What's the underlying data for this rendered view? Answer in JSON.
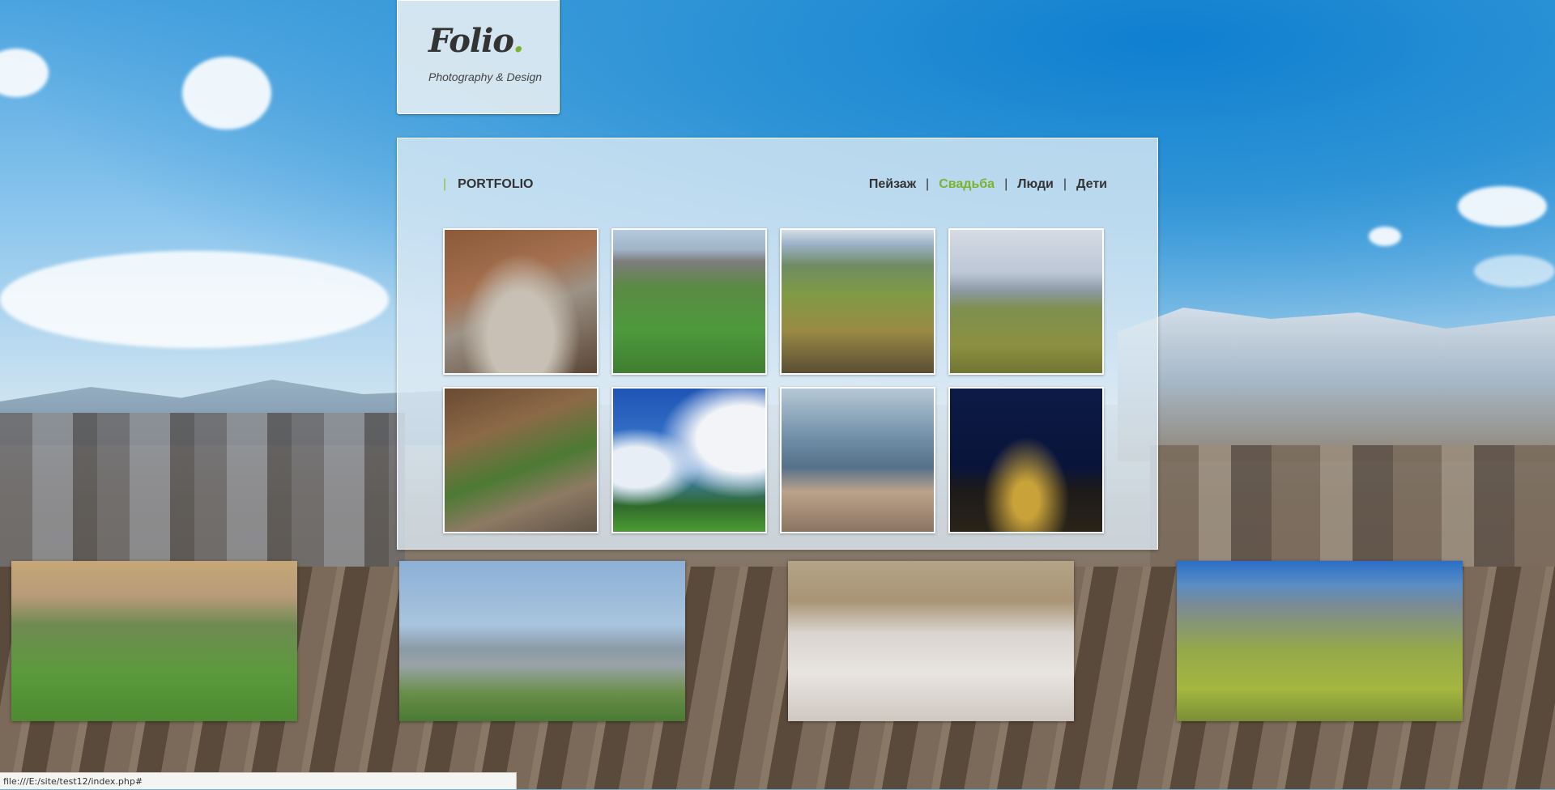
{
  "logo": {
    "title": "Folio",
    "dot": ".",
    "subtitle": "Photography & Design"
  },
  "portfolio": {
    "separator": "|",
    "title": "PORTFOLIO",
    "filters": [
      {
        "label": "Пейзаж",
        "active": false
      },
      {
        "label": "Свадьба",
        "active": true
      },
      {
        "label": "Люди",
        "active": false
      },
      {
        "label": "Дети",
        "active": false
      }
    ],
    "filter_separator": "|",
    "thumbnails": [
      {
        "name": "mountain-village-cliff"
      },
      {
        "name": "football-field"
      },
      {
        "name": "green-valley-canyon"
      },
      {
        "name": "plateau-meadow"
      },
      {
        "name": "rocky-canyon-waterfall"
      },
      {
        "name": "monument-blue-sky"
      },
      {
        "name": "cliff-edge-mountains"
      },
      {
        "name": "night-city-lights"
      }
    ]
  },
  "gallery_strip": [
    {
      "name": "meadow-sunset"
    },
    {
      "name": "town-valley-view"
    },
    {
      "name": "snowy-village"
    },
    {
      "name": "aerial-fields"
    }
  ],
  "statusbar": {
    "url": "file:///E:/site/test12/index.php#"
  },
  "colors": {
    "accent": "#7ab32e",
    "text": "#333333"
  }
}
